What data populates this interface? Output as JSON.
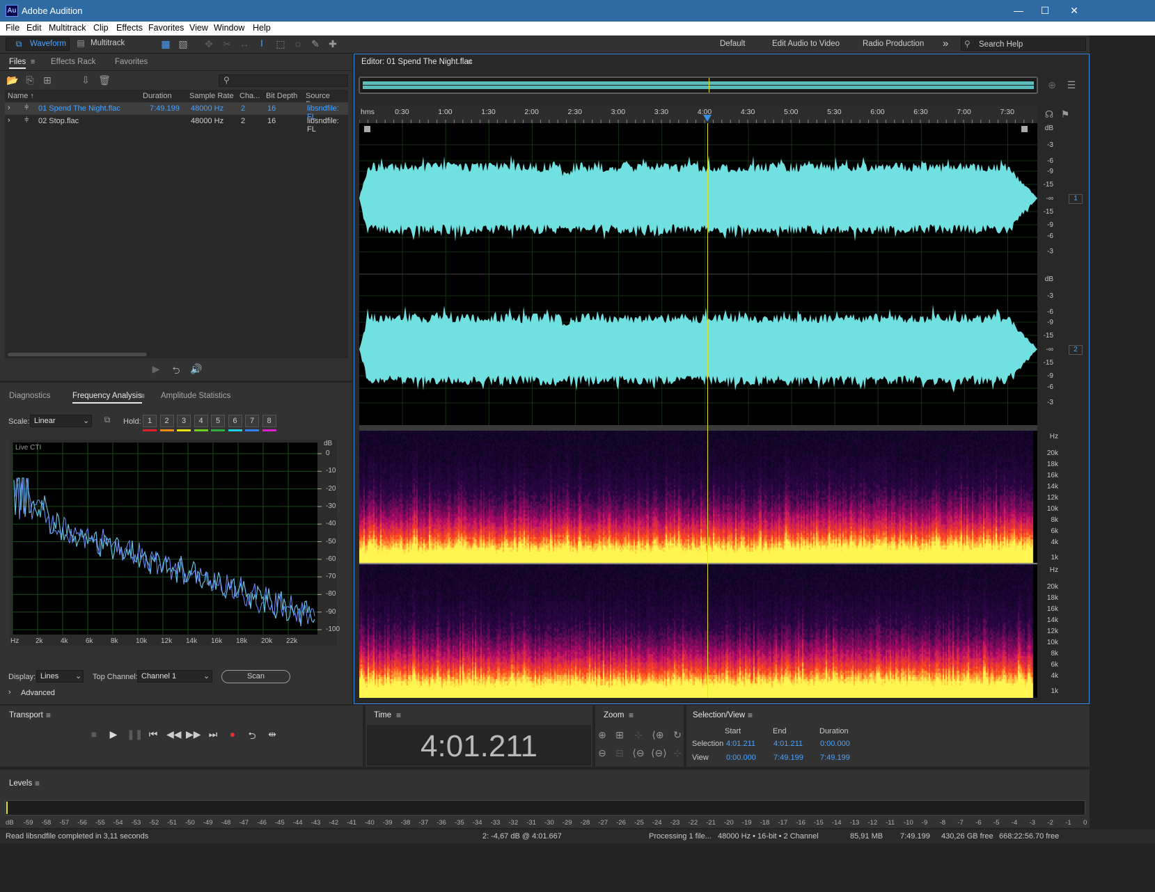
{
  "app": {
    "title": "Adobe Audition",
    "logo": "Au"
  },
  "window_controls": {
    "minimize": "—",
    "maximize": "☐",
    "close": "✕"
  },
  "menu": [
    "File",
    "Edit",
    "Multitrack",
    "Clip",
    "Effects",
    "Favorites",
    "View",
    "Window",
    "Help"
  ],
  "toolbar": {
    "waveform_label": "Waveform",
    "multitrack_label": "Multitrack",
    "workspaces": [
      "Default",
      "Edit Audio to Video",
      "Radio Production"
    ],
    "more": "»",
    "search_placeholder": "Search Help"
  },
  "files_panel": {
    "tabs": [
      "Files",
      "Effects Rack",
      "Favorites"
    ],
    "columns": [
      "Name ↑",
      "Duration",
      "Sample Rate",
      "Cha...",
      "Bit Depth",
      "Source Forma"
    ],
    "rows": [
      {
        "name": "01 Spend The Night.flac",
        "duration": "7:49.199",
        "rate": "48000 Hz",
        "ch": "2",
        "bits": "16",
        "src": "libsndfile: FL",
        "selected": true
      },
      {
        "name": "02 Stop.flac",
        "duration": "",
        "rate": "48000 Hz",
        "ch": "2",
        "bits": "16",
        "src": "libsndfile: FL",
        "selected": false
      }
    ]
  },
  "analysis_panel": {
    "tabs": [
      "Diagnostics",
      "Frequency Analysis",
      "Amplitude Statistics"
    ],
    "scale_label": "Scale:",
    "scale_value": "Linear",
    "hold_label": "Hold:",
    "hold_buttons": [
      "1",
      "2",
      "3",
      "4",
      "5",
      "6",
      "7",
      "8"
    ],
    "hold_colors": [
      "#e0202a",
      "#f08a10",
      "#e8e010",
      "#70d020",
      "#30b040",
      "#20d0e0",
      "#3080f0",
      "#e020d0"
    ],
    "graph_title": "Live CTI",
    "db_unit": "dB",
    "db_ticks": [
      "0",
      "-10",
      "-20",
      "-30",
      "-40",
      "-50",
      "-60",
      "-70",
      "-80",
      "-90",
      "-100"
    ],
    "hz_ticks": [
      "Hz",
      "2k",
      "4k",
      "6k",
      "8k",
      "10k",
      "12k",
      "14k",
      "16k",
      "18k",
      "20k",
      "22k"
    ],
    "display_label": "Display:",
    "display_value": "Lines",
    "top_channel_label": "Top Channel:",
    "top_channel_value": "Channel 1",
    "scan_label": "Scan",
    "advanced_label": "Advanced"
  },
  "editor": {
    "title": "Editor: 01 Spend The Night.flac",
    "ruler": [
      "hms",
      "0:30",
      "1:00",
      "1:30",
      "2:00",
      "2:30",
      "3:00",
      "3:30",
      "4:00",
      "4:30",
      "5:00",
      "5:30",
      "6:00",
      "6:30",
      "7:00",
      "7:30"
    ],
    "db_ticks": [
      "dB",
      "-3",
      "-6",
      "-9",
      "-15",
      "-∞",
      "-15",
      "-9",
      "-6",
      "-3"
    ],
    "hz_ticks": [
      "Hz",
      "20k",
      "18k",
      "16k",
      "14k",
      "12k",
      "10k",
      "8k",
      "6k",
      "4k",
      "1k"
    ],
    "channel1": "1",
    "channel2": "2"
  },
  "transport": {
    "title": "Transport"
  },
  "time_panel": {
    "title": "Time",
    "value": "4:01.211"
  },
  "zoom_panel": {
    "title": "Zoom"
  },
  "selection_panel": {
    "title": "Selection/View",
    "headers": [
      "Start",
      "End",
      "Duration"
    ],
    "selection_label": "Selection",
    "selection": [
      "4:01.211",
      "4:01.211",
      "0:00.000"
    ],
    "view_label": "View",
    "view": [
      "0:00.000",
      "7:49.199",
      "7:49.199"
    ]
  },
  "levels": {
    "title": "Levels",
    "ticks": [
      "dB",
      "-59",
      "-58",
      "-57",
      "-56",
      "-55",
      "-54",
      "-53",
      "-52",
      "-51",
      "-50",
      "-49",
      "-48",
      "-47",
      "-46",
      "-45",
      "-44",
      "-43",
      "-42",
      "-41",
      "-40",
      "-39",
      "-38",
      "-37",
      "-36",
      "-35",
      "-34",
      "-33",
      "-32",
      "-31",
      "-30",
      "-29",
      "-28",
      "-27",
      "-26",
      "-25",
      "-24",
      "-23",
      "-22",
      "-21",
      "-20",
      "-19",
      "-18",
      "-17",
      "-16",
      "-15",
      "-14",
      "-13",
      "-12",
      "-11",
      "-10",
      "-9",
      "-8",
      "-7",
      "-6",
      "-5",
      "-4",
      "-3",
      "-2",
      "-1",
      "0"
    ]
  },
  "status": {
    "left": "Read libsndfile completed in 3,11 seconds",
    "cursor": "2: -4,67 dB @ 4:01.667",
    "processing": "Processing 1 file...",
    "format": "48000 Hz • 16-bit • 2 Channel",
    "size": "85,91 MB",
    "duration": "7:49.199",
    "free": "430,26 GB free",
    "free_time": "668:22:56.70 free"
  }
}
